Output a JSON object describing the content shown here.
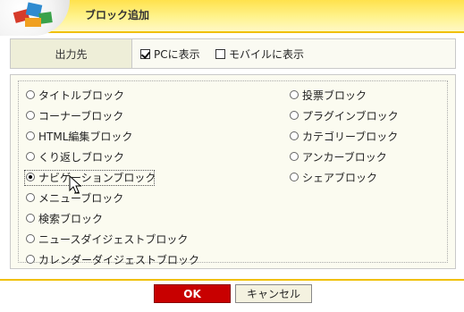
{
  "dialog": {
    "title": "ブロック追加"
  },
  "output": {
    "label": "出力先",
    "pc_label": "PCに表示",
    "pc_checked": true,
    "mobile_label": "モバイルに表示",
    "mobile_checked": false
  },
  "blocks": {
    "selected": "ナビゲーションブロック",
    "left": [
      "タイトルブロック",
      "コーナーブロック",
      "HTML編集ブロック",
      "くり返しブロック",
      "ナビゲーションブロック",
      "メニューブロック",
      "検索ブロック",
      "ニュースダイジェストブロック",
      "カレンダーダイジェストブロック"
    ],
    "right": [
      "投票ブロック",
      "プラグインブロック",
      "カテゴリーブロック",
      "アンカーブロック",
      "シェアブロック"
    ]
  },
  "buttons": {
    "ok": "OK",
    "cancel": "キャンセル"
  }
}
